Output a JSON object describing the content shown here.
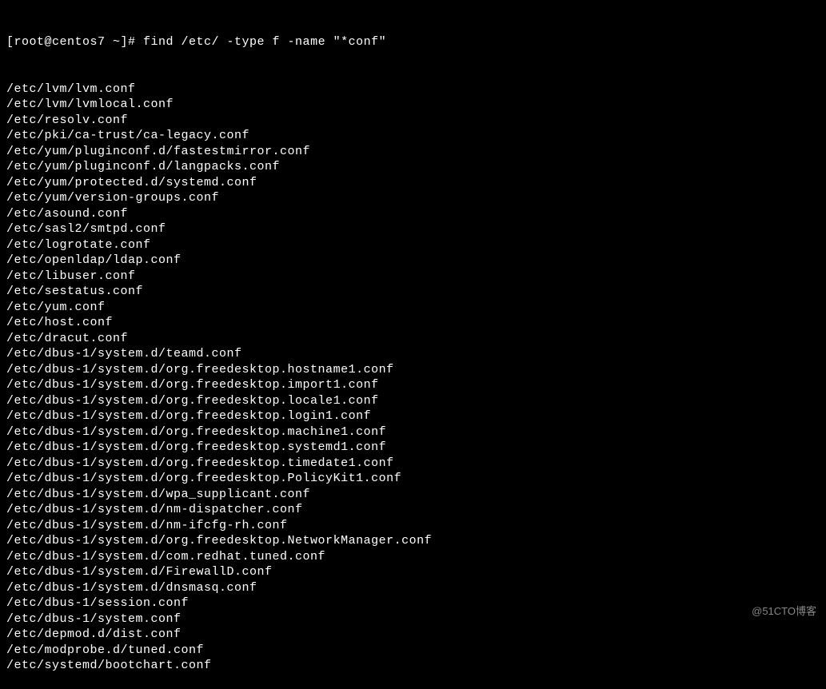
{
  "prompt": "[root@centos7 ~]# ",
  "command": "find /etc/ -type f -name \"*conf\"",
  "output": [
    "/etc/lvm/lvm.conf",
    "/etc/lvm/lvmlocal.conf",
    "/etc/resolv.conf",
    "/etc/pki/ca-trust/ca-legacy.conf",
    "/etc/yum/pluginconf.d/fastestmirror.conf",
    "/etc/yum/pluginconf.d/langpacks.conf",
    "/etc/yum/protected.d/systemd.conf",
    "/etc/yum/version-groups.conf",
    "/etc/asound.conf",
    "/etc/sasl2/smtpd.conf",
    "/etc/logrotate.conf",
    "/etc/openldap/ldap.conf",
    "/etc/libuser.conf",
    "/etc/sestatus.conf",
    "/etc/yum.conf",
    "/etc/host.conf",
    "/etc/dracut.conf",
    "/etc/dbus-1/system.d/teamd.conf",
    "/etc/dbus-1/system.d/org.freedesktop.hostname1.conf",
    "/etc/dbus-1/system.d/org.freedesktop.import1.conf",
    "/etc/dbus-1/system.d/org.freedesktop.locale1.conf",
    "/etc/dbus-1/system.d/org.freedesktop.login1.conf",
    "/etc/dbus-1/system.d/org.freedesktop.machine1.conf",
    "/etc/dbus-1/system.d/org.freedesktop.systemd1.conf",
    "/etc/dbus-1/system.d/org.freedesktop.timedate1.conf",
    "/etc/dbus-1/system.d/org.freedesktop.PolicyKit1.conf",
    "/etc/dbus-1/system.d/wpa_supplicant.conf",
    "/etc/dbus-1/system.d/nm-dispatcher.conf",
    "/etc/dbus-1/system.d/nm-ifcfg-rh.conf",
    "/etc/dbus-1/system.d/org.freedesktop.NetworkManager.conf",
    "/etc/dbus-1/system.d/com.redhat.tuned.conf",
    "/etc/dbus-1/system.d/FirewallD.conf",
    "/etc/dbus-1/system.d/dnsmasq.conf",
    "/etc/dbus-1/session.conf",
    "/etc/dbus-1/system.conf",
    "/etc/depmod.d/dist.conf",
    "/etc/modprobe.d/tuned.conf",
    "/etc/systemd/bootchart.conf"
  ],
  "watermark": "@51CTO博客"
}
